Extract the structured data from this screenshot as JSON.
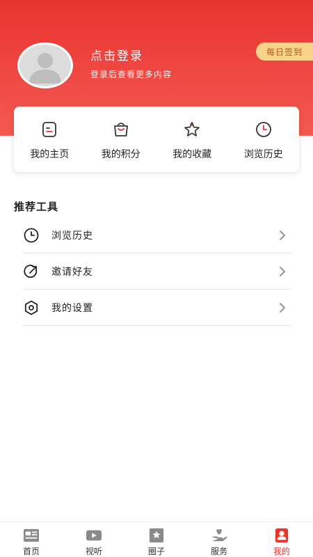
{
  "header": {
    "login_title": "点击登录",
    "login_subtitle": "登录后查看更多内容",
    "checkin_label": "每日签到"
  },
  "quick_actions": [
    {
      "label": "我的主页",
      "icon": "homepage-icon"
    },
    {
      "label": "我的积分",
      "icon": "points-bag-icon"
    },
    {
      "label": "我的收藏",
      "icon": "star-icon"
    },
    {
      "label": "浏览历史",
      "icon": "clock-icon"
    }
  ],
  "tools": {
    "title": "推荐工具",
    "items": [
      {
        "label": "浏览历史",
        "icon": "clock-icon"
      },
      {
        "label": "邀请好友",
        "icon": "share-icon"
      },
      {
        "label": "我的设置",
        "icon": "settings-icon"
      }
    ]
  },
  "tabbar": {
    "items": [
      {
        "label": "首页",
        "icon": "news-icon"
      },
      {
        "label": "视听",
        "icon": "video-icon"
      },
      {
        "label": "圈子",
        "icon": "circle-icon"
      },
      {
        "label": "服务",
        "icon": "service-icon"
      },
      {
        "label": "我的",
        "icon": "profile-icon",
        "active": true
      }
    ]
  },
  "colors": {
    "accent": "#e8342f",
    "checkin_bg": "#f7d48a",
    "checkin_text": "#b15a16"
  }
}
